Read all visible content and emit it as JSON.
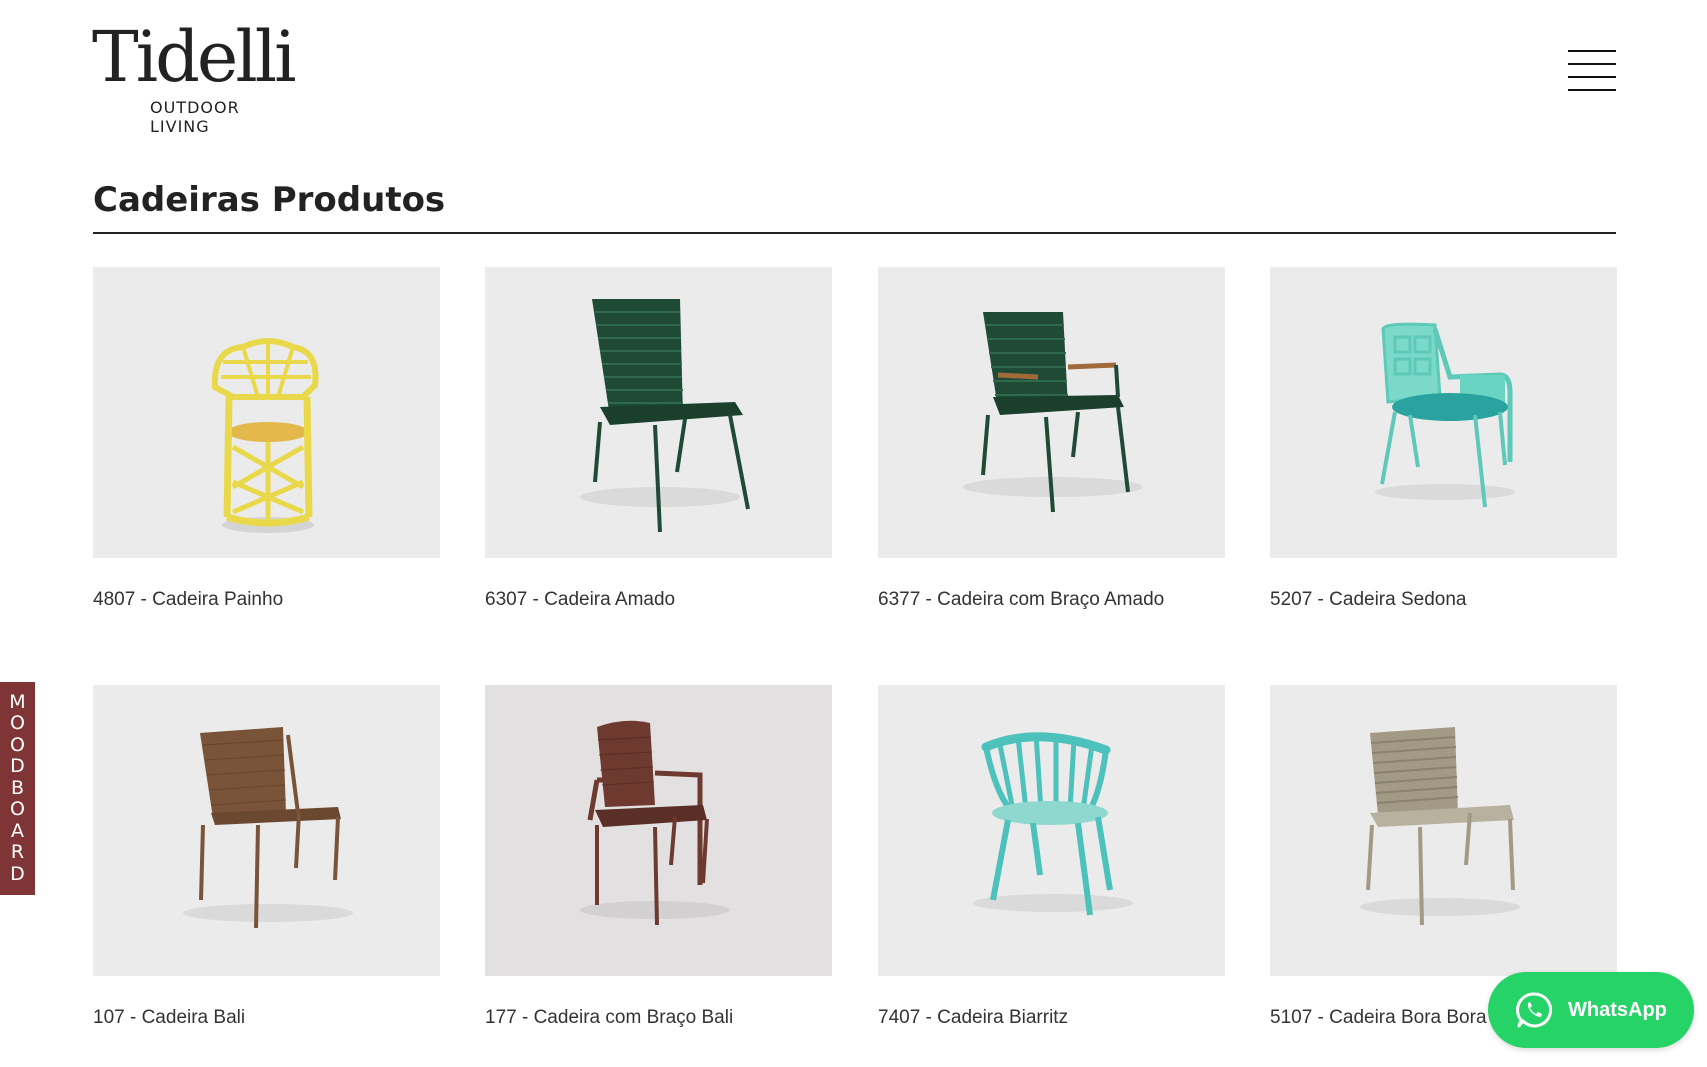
{
  "brand": {
    "name": "Tidelli",
    "tagline": "OUTDOOR LIVING"
  },
  "header": {
    "menu_icon": "hamburger-menu-icon"
  },
  "page": {
    "title": "Cadeiras Produtos"
  },
  "products": [
    {
      "label": "4807 - Cadeira Painho",
      "color": "#e9d94a"
    },
    {
      "label": "6307 - Cadeira Amado",
      "color": "#1f4a35"
    },
    {
      "label": "6377 - Cadeira com Braço Amado",
      "color": "#1f4a35"
    },
    {
      "label": "5207 - Cadeira Sedona",
      "color": "#5ec9b8"
    },
    {
      "label": "107 - Cadeira Bali",
      "color": "#7a5438"
    },
    {
      "label": "177 - Cadeira com Braço Bali",
      "color": "#6e3a30"
    },
    {
      "label": "7407 - Cadeira Biarritz",
      "color": "#4dc1bb"
    },
    {
      "label": "5107 - Cadeira Bora Bora",
      "color": "#a39a86"
    }
  ],
  "moodboard": {
    "letters": [
      "M",
      "O",
      "O",
      "D",
      "B",
      "O",
      "A",
      "R",
      "D"
    ],
    "color": "#7f3535"
  },
  "whatsapp": {
    "label": "WhatsApp",
    "color": "#25d366",
    "icon": "whatsapp-icon"
  }
}
